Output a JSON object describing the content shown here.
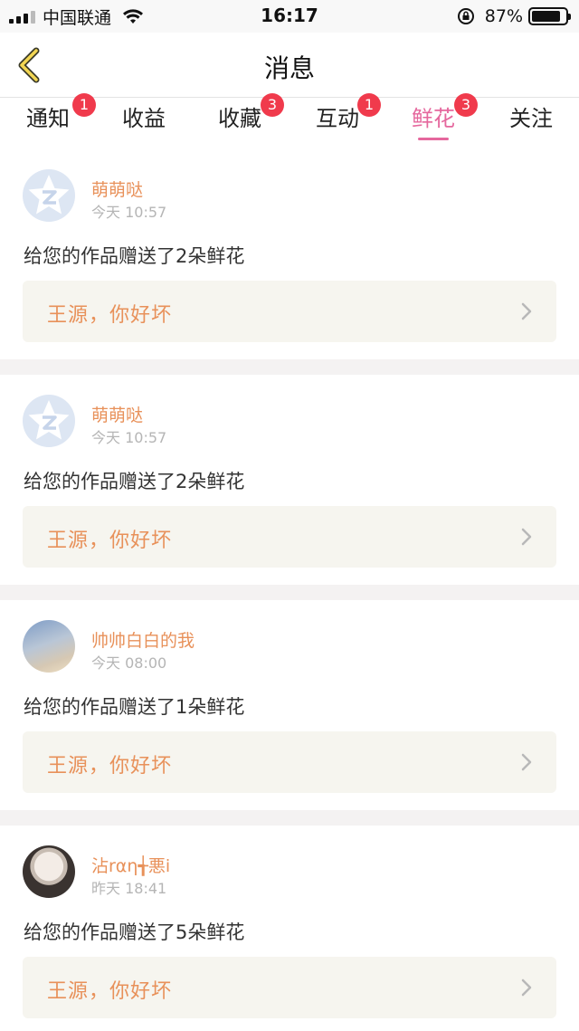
{
  "status_bar": {
    "carrier": "中国联通",
    "time": "16:17",
    "battery": "87%",
    "battery_level": 0.87
  },
  "nav": {
    "title": "消息"
  },
  "tabs": [
    {
      "label": "通知",
      "badge": "1",
      "active": false
    },
    {
      "label": "收益",
      "badge": "",
      "active": false
    },
    {
      "label": "收藏",
      "badge": "3",
      "active": false
    },
    {
      "label": "互动",
      "badge": "1",
      "active": false
    },
    {
      "label": "鲜花",
      "badge": "3",
      "active": true
    },
    {
      "label": "关注",
      "badge": "",
      "active": false
    }
  ],
  "colors": {
    "accent": "#e5679d",
    "badge": "#f03a4c",
    "username": "#e8915a",
    "work_bg": "#f6f5ef"
  },
  "feed": [
    {
      "username": "萌萌哒",
      "time": "今天 10:57",
      "message": "给您的作品赠送了2朵鲜花",
      "work_title": "王源，你好坏",
      "avatar": "qzone-default-avatar"
    },
    {
      "username": "萌萌哒",
      "time": "今天 10:57",
      "message": "给您的作品赠送了2朵鲜花",
      "work_title": "王源，你好坏",
      "avatar": "qzone-default-avatar"
    },
    {
      "username": "帅帅白白的我",
      "time": "今天 08:00",
      "message": "给您的作品赠送了1朵鲜花",
      "work_title": "王源，你好坏",
      "avatar": "sky-photo-avatar"
    },
    {
      "username": "沾rαη╅悪i",
      "time": "昨天 18:41",
      "message": "给您的作品赠送了5朵鲜花",
      "work_title": "王源，你好坏",
      "avatar": "portrait-photo-avatar"
    }
  ]
}
